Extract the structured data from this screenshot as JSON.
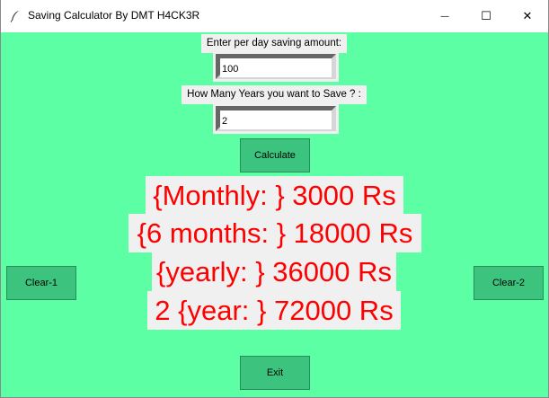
{
  "window": {
    "title": "Saving Calculator By DMT H4CK3R",
    "minimize_glyph": "—",
    "maximize_glyph": "☐",
    "close_glyph": "✕"
  },
  "form": {
    "per_day_label": "Enter per day saving amount:",
    "per_day_value": "100",
    "years_label": "How Many Years you want to Save ? :",
    "years_value": "2"
  },
  "buttons": {
    "calculate": "Calculate",
    "clear1": "Clear-1",
    "clear2": "Clear-2",
    "exit": "Exit"
  },
  "results": {
    "monthly": "{Monthly: } 3000 Rs",
    "six_months": "{6 months: } 18000 Rs",
    "yearly": "{yearly: } 36000 Rs",
    "years_total": "2 {year: } 72000 Rs"
  },
  "colors": {
    "background": "#5cffa3",
    "button": "#3cc47f",
    "result_text": "#ff0000"
  }
}
